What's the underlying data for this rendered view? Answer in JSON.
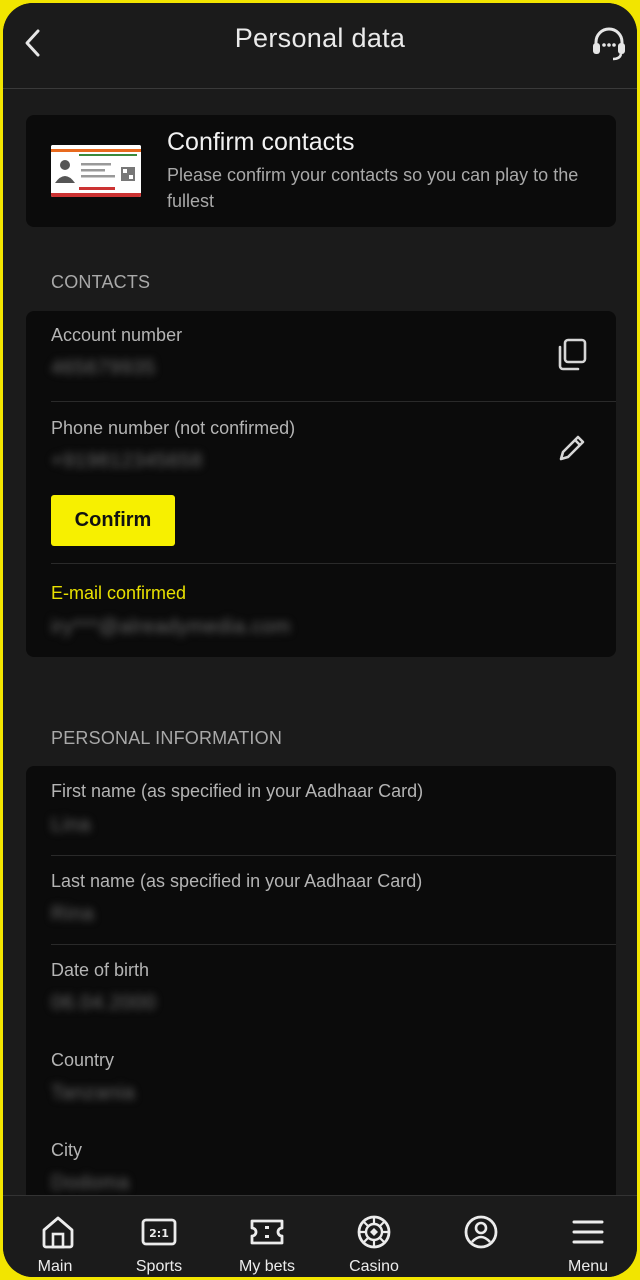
{
  "header": {
    "title": "Personal data"
  },
  "promo": {
    "title": "Confirm contacts",
    "text": "Please confirm your contacts so you can play to the fullest"
  },
  "contacts": {
    "section_title": "CONTACTS",
    "account_label": "Account number",
    "account_value": "465679935",
    "phone_label": "Phone number (not confirmed)",
    "phone_value": "+919812345658",
    "confirm_label": "Confirm",
    "email_label": "E-mail confirmed",
    "email_value": "iry***@alreadymedia.com"
  },
  "personal": {
    "section_title": "PERSONAL INFORMATION",
    "fields": [
      {
        "label": "First name (as specified in your Aadhaar Card)",
        "value": "Lina"
      },
      {
        "label": "Last name (as specified in your Aadhaar Card)",
        "value": "Rina"
      },
      {
        "label": "Date of birth",
        "value": "06.04.2000"
      },
      {
        "label": "Country",
        "value": "Tanzania"
      },
      {
        "label": "City",
        "value": "Dodoma"
      }
    ]
  },
  "nav": {
    "items": [
      {
        "label": "Main",
        "icon": "home-icon"
      },
      {
        "label": "Sports",
        "icon": "scoreboard-icon"
      },
      {
        "label": "My bets",
        "icon": "ticket-icon"
      },
      {
        "label": "Casino",
        "icon": "chip-icon"
      },
      {
        "label": "",
        "icon": "profile-icon"
      },
      {
        "label": "Menu",
        "icon": "hamburger-icon"
      }
    ]
  },
  "colors": {
    "accent": "#f7f000",
    "background": "#1b1b1b",
    "card": "#0b0b0b",
    "frame": "#f2e500"
  }
}
